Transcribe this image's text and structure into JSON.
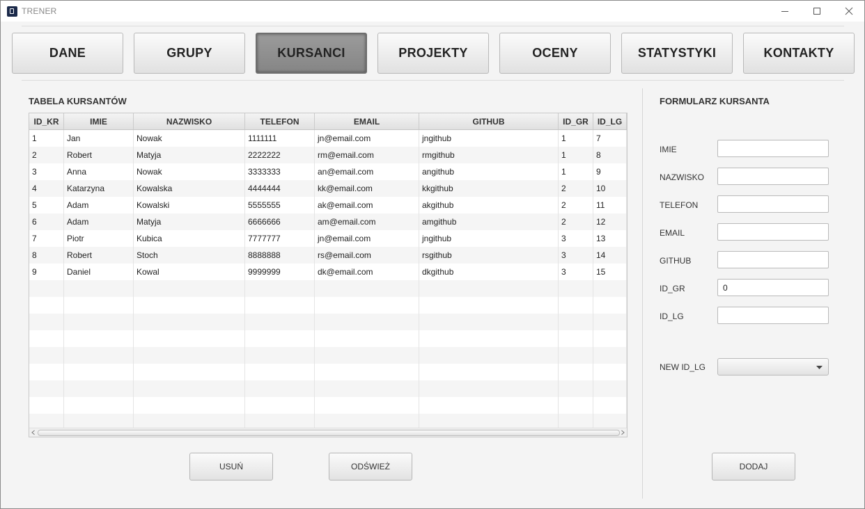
{
  "window": {
    "title": "TRENER"
  },
  "nav": [
    {
      "label": "DANE",
      "active": false
    },
    {
      "label": "GRUPY",
      "active": false
    },
    {
      "label": "KURSANCI",
      "active": true
    },
    {
      "label": "PROJEKTY",
      "active": false
    },
    {
      "label": "OCENY",
      "active": false
    },
    {
      "label": "STATYSTYKI",
      "active": false
    },
    {
      "label": "KONTAKTY",
      "active": false
    }
  ],
  "table": {
    "title": "TABELA KURSANTÓW",
    "columns": [
      "ID_KR",
      "IMIE",
      "NAZWISKO",
      "TELEFON",
      "EMAIL",
      "GITHUB",
      "ID_GR",
      "ID_LG"
    ],
    "rows": [
      [
        "1",
        "Jan",
        "Nowak",
        "1111111",
        "jn@email.com",
        "jngithub",
        "1",
        "7"
      ],
      [
        "2",
        "Robert",
        "Matyja",
        "2222222",
        "rm@email.com",
        "rmgithub",
        "1",
        "8"
      ],
      [
        "3",
        "Anna",
        "Nowak",
        "3333333",
        "an@email.com",
        "angithub",
        "1",
        "9"
      ],
      [
        "4",
        "Katarzyna",
        "Kowalska",
        "4444444",
        "kk@email.com",
        "kkgithub",
        "2",
        "10"
      ],
      [
        "5",
        "Adam",
        "Kowalski",
        "5555555",
        "ak@email.com",
        "akgithub",
        "2",
        "11"
      ],
      [
        "6",
        "Adam",
        "Matyja",
        "6666666",
        "am@email.com",
        "amgithub",
        "2",
        "12"
      ],
      [
        "7",
        "Piotr",
        "Kubica",
        "7777777",
        "jn@email.com",
        "jngithub",
        "3",
        "13"
      ],
      [
        "8",
        "Robert",
        "Stoch",
        "8888888",
        "rs@email.com",
        "rsgithub",
        "3",
        "14"
      ],
      [
        "9",
        "Daniel",
        "Kowal",
        "9999999",
        "dk@email.com",
        "dkgithub",
        "3",
        "15"
      ]
    ]
  },
  "form": {
    "title": "FORMULARZ KURSANTA",
    "fields": [
      {
        "label": "IMIE",
        "value": ""
      },
      {
        "label": "NAZWISKO",
        "value": ""
      },
      {
        "label": "TELEFON",
        "value": ""
      },
      {
        "label": "EMAIL",
        "value": ""
      },
      {
        "label": "GITHUB",
        "value": ""
      },
      {
        "label": "ID_GR",
        "value": "0"
      },
      {
        "label": "ID_LG",
        "value": ""
      }
    ],
    "new_id_lg_label": "NEW ID_LG",
    "new_id_lg_value": ""
  },
  "buttons": {
    "delete": "USUŃ",
    "refresh": "ODŚWIEŻ",
    "add": "DODAJ"
  }
}
